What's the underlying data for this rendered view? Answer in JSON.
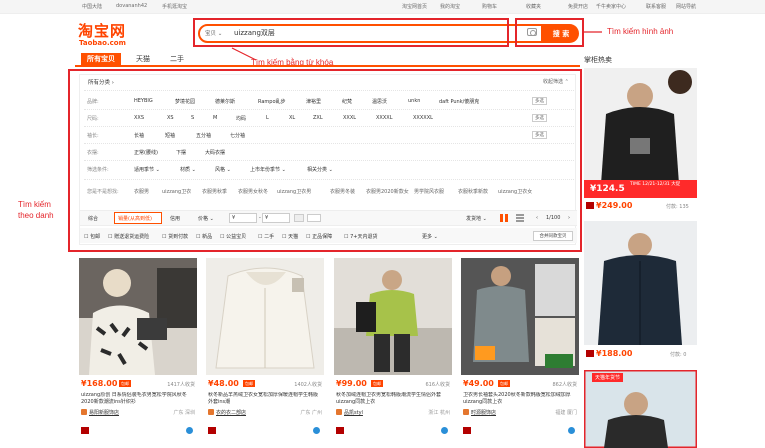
{
  "topbar": {
    "left_items": [
      "中国大陆",
      "dovananh42",
      "手机逛淘宝"
    ],
    "right_items": [
      "淘宝网首页",
      "我的淘宝",
      "购物车",
      "收藏夹",
      "免费开店",
      "千牛卖家中心",
      "联系客服",
      "网站导航"
    ]
  },
  "logo": {
    "zh": "淘宝网",
    "en": "Taobao.com"
  },
  "search": {
    "scope": "宝贝",
    "query": "uizzang双层",
    "button": "搜 索"
  },
  "annotations": {
    "keyword": "Tìm kiếm bằng từ khóa",
    "image": "Tìm kiếm hình ảnh",
    "category_line1": "Tìm kiếm",
    "category_line2": "theo danh"
  },
  "tabs": [
    "所有宝贝",
    "天猫",
    "二手"
  ],
  "side_title": "掌柜热卖",
  "filter": {
    "breadcrumb": "所有分类 ›",
    "collapse": "收起筛选 ⌃",
    "rows": [
      {
        "label": "品牌:",
        "values": [
          "HEYBIG",
          "梦境花园",
          "德莱尔斯",
          "Rampo乱步",
          "津裕里",
          "纪梵",
          "温思沃",
          "unkn",
          "daft Punk/傻朋克"
        ],
        "more": "多选"
      },
      {
        "label": "尺码:",
        "values": [
          "XXS",
          "XS",
          "S",
          "M",
          "均码",
          "L",
          "XL",
          "ZXL",
          "XXXL",
          "XXXXL",
          "XXXXXL"
        ],
        "more": "多选"
      },
      {
        "label": "袖长:",
        "values": [
          "长袖",
          "短袖",
          "五分袖",
          "七分袖"
        ],
        "more": "多选"
      },
      {
        "label": "衣摆:",
        "values": [
          "正常(腰线)",
          "下摆",
          "大码衣摆"
        ],
        "more": ""
      },
      {
        "label": "筛选条件:",
        "values": [
          "适用季节 ⌄",
          "材质 ⌄",
          "风格 ⌄",
          "上市年份季节 ⌄",
          "相关分类 ⌄"
        ],
        "more": ""
      }
    ],
    "suggest_label": "您是不是想找:",
    "suggest": [
      "衣服男",
      "uizzang卫衣",
      "衣服男秋季",
      "衣服男女秋冬",
      "uizzang卫衣男",
      "衣服男冬装",
      "衣服男2020新款女",
      "男学院风衣服",
      "衣服秋季新款",
      "uizzang卫衣女"
    ],
    "sort_items": [
      "综合",
      "销量(从高到低)",
      "信用",
      "价格 ⌄"
    ],
    "price_from": "¥",
    "price_to": "¥",
    "ship_label": "发货地 ⌄",
    "pager": "1/100",
    "checks": [
      "包邮",
      "赠送退货运费险",
      "货到付款",
      "新品",
      "公益宝贝",
      "二手",
      "天猫",
      "正品保障",
      "7+天内退货"
    ],
    "checks_more": "更多 ⌄",
    "checks_right": "合并同款宝贝"
  },
  "products": [
    {
      "price": "¥168.00",
      "sold": "1417人收货",
      "title": "uizzang原创 日系情侣装毛衣男宽松学院风秋冬2020新款潮流ins针织衫",
      "shop": "易阳新服饰店",
      "loc": "广东 深圳"
    },
    {
      "price": "¥48.00",
      "sold": "1402人收货",
      "title": "秋冬新品羊羔绒卫衣女宽松加厚保暖连帽学生韩版外套ins潮",
      "shop": "衣的衣二部店",
      "loc": "广东 广州"
    },
    {
      "price": "¥99.00",
      "sold": "616人收货",
      "title": "秋冬加绒连帽卫衣男宽松韩版潮流学生情侣外套uizzang同款上衣",
      "shop": "品凯styl",
      "loc": "浙江 杭州"
    },
    {
      "price": "¥49.00",
      "sold": "862人收货",
      "title": "卫衣男长袖套头2020秋冬新款韩版宽松加绒加厚uizzang同款上衣",
      "shop": "时源服饰店",
      "loc": "福建 厦门"
    }
  ],
  "side_products": [
    {
      "price": "¥249.00",
      "sold": "付款: 135",
      "promo_price": "¥124.5",
      "promo_text": "TIME 12/21-12/31 大促"
    },
    {
      "price": "¥188.00",
      "sold": "付款: 0"
    },
    {
      "banner": "天猫年货节"
    }
  ],
  "colors": {
    "accent": "#ff5000",
    "annotation": "#e4252b",
    "price": "#ff4400"
  }
}
